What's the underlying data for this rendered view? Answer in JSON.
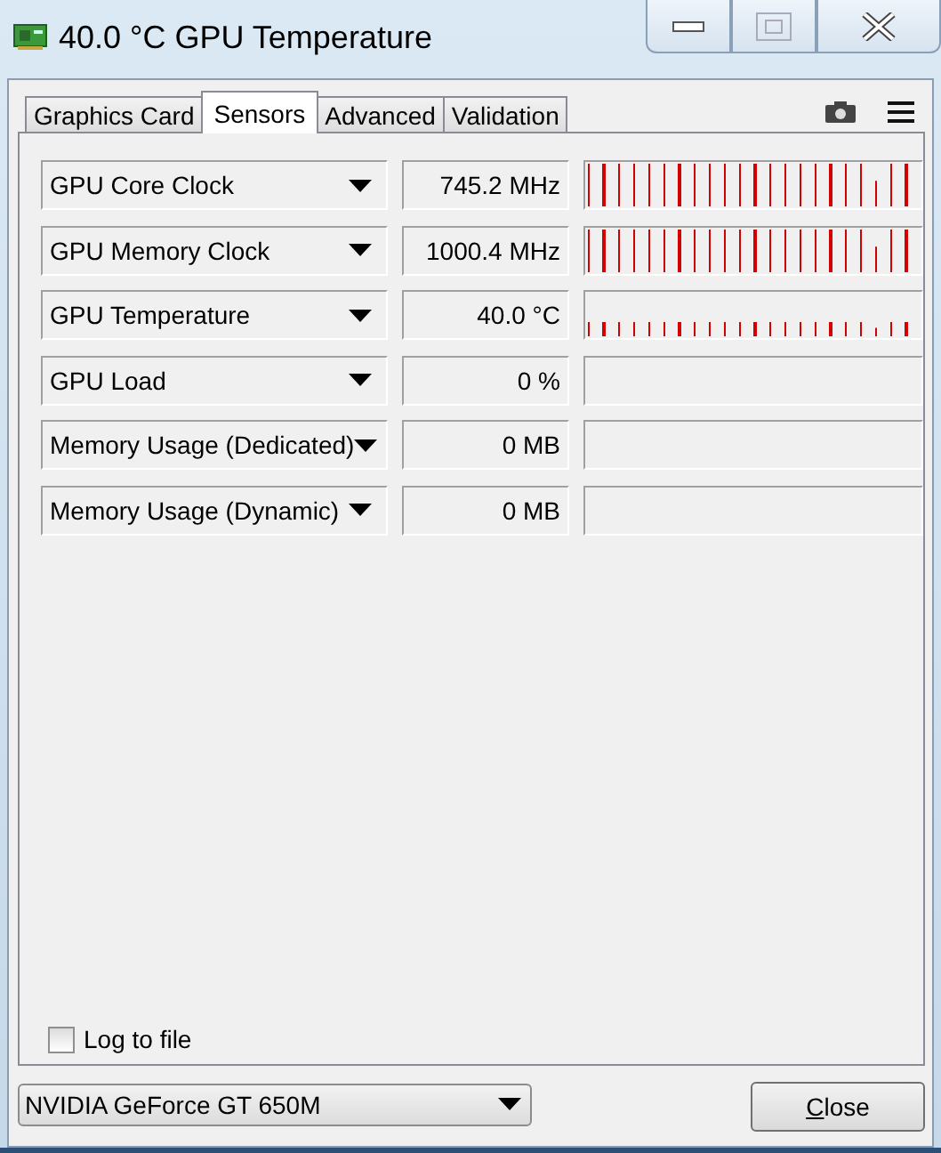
{
  "window": {
    "title": "40.0 °C GPU Temperature"
  },
  "tabs": [
    {
      "label": "Graphics Card",
      "selected": false
    },
    {
      "label": "Sensors",
      "selected": true
    },
    {
      "label": "Advanced",
      "selected": false
    },
    {
      "label": "Validation",
      "selected": false
    }
  ],
  "sensors": [
    {
      "name": "GPU Core Clock",
      "value": "745.2 MHz",
      "kind": "full"
    },
    {
      "name": "GPU Memory Clock",
      "value": "1000.4 MHz",
      "kind": "full"
    },
    {
      "name": "GPU Temperature",
      "value": "40.0 °C",
      "kind": "low"
    },
    {
      "name": "GPU Load",
      "value": "0 %",
      "kind": "idle"
    },
    {
      "name": "Memory Usage (Dedicated)",
      "value": "0 MB",
      "kind": "idle"
    },
    {
      "name": "Memory Usage (Dynamic)",
      "value": "0 MB",
      "kind": "idle"
    }
  ],
  "log_to_file": {
    "label": "Log to file",
    "checked": false
  },
  "device_select": {
    "value": "NVIDIA GeForce GT 650M"
  },
  "close_button": {
    "label": "Close"
  }
}
